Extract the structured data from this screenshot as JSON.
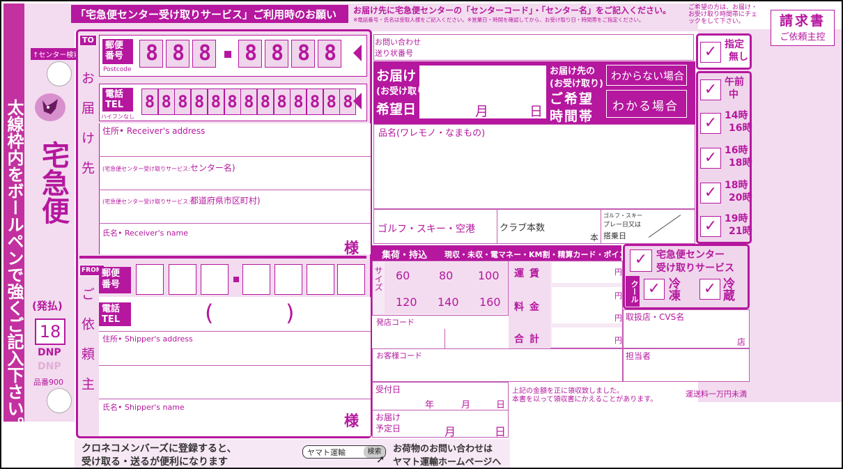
{
  "header": {
    "title": "「宅急便センター受け取りサービス」ご利用時のお願い",
    "notice_1": "お届け先に宅急便センターの「センターコード」・「センター名」をご記入ください。",
    "notice_2": "※電話番号・氏名は受取人様をご記入ください。※営業日・時間を確認してから、お受け取り日・時間帯をご指定ください。",
    "notice_3": "ご希望の方は、お届け・お受け取り時間帯にチェックをして下さい。"
  },
  "left_strip": {
    "search_label": "↑センター検索",
    "instruction": "太線枠内をボールペンで強くご記入下さい。",
    "brand": "宅急便",
    "brand_sub": "(発払)",
    "number": "18",
    "maker": "DNP",
    "maker_ghost": "DNP",
    "product_no": "品番900"
  },
  "to": {
    "badge": "TO",
    "title": "お届け先",
    "postcode_label": "郵便番号",
    "postcode_en": "Postcode",
    "postcode_digits": [
      "8",
      "8",
      "8",
      "8",
      "8",
      "8",
      "8"
    ],
    "tel_label": "電話TEL",
    "tel_note": "ハイフンなし",
    "tel_digits": [
      "8",
      "8",
      "8",
      "8",
      "8",
      "8",
      "8",
      "8",
      "8",
      "8",
      "8",
      "8",
      "8"
    ],
    "address_label": "住所• Receiver's address",
    "center_name_note": "(宅急便センター受け取りサービス:",
    "center_name_label": "センター名)",
    "prefecture_note": "(宅急便センター受け取りサービス:",
    "prefecture_label": "都道府県市区町村)",
    "name_label": "氏名• Receiver's name",
    "sama": "様"
  },
  "from": {
    "badge": "FROM",
    "title": "ご依頼主",
    "postcode_label": "郵便番号",
    "tel_label": "電話TEL",
    "paren_open": "(",
    "paren_close": ")",
    "address_label": "住所• Shipper's address",
    "name_label": "氏名• Shipper's name",
    "sama": "様"
  },
  "inquiry": {
    "label_1": "お問い合わせ",
    "label_2": "送り状番号"
  },
  "delivery_date": {
    "label_1": "お届け",
    "label_2": "(お受け取り)",
    "label_3": "希望日",
    "month": "月",
    "day": "日"
  },
  "time_band": {
    "label_1": "お届け先の",
    "label_2": "(お受け取り)",
    "label_3": "ご希望",
    "label_4": "時間帯",
    "unknown": "わからない場合",
    "known": "わかる場合"
  },
  "item": {
    "label": "品名(ワレモノ・なまもの)"
  },
  "golf": {
    "label": "ゴルフ・スキー・空港",
    "clubs": "クラブ本数",
    "clubs_unit": "本",
    "play_1": "ゴルフ・スキー",
    "play_2": "プレー日又は",
    "play_3": "搭乗日"
  },
  "time_options": [
    {
      "line1": "指定",
      "line2": "無し"
    },
    {
      "line1": "午前",
      "line2": "中"
    },
    {
      "line1": "14時",
      "line2": "16時"
    },
    {
      "line1": "16時",
      "line2": "18時"
    },
    {
      "line1": "18時",
      "line2": "20時"
    },
    {
      "line1": "19時",
      "line2": "21時"
    }
  ],
  "invoice": {
    "title": "請求書",
    "subtitle": "ご依頼主控"
  },
  "pickup": {
    "label": "集荷・持込",
    "payments": "現収・未収・電マネー・KM割・精算カード・ポイント"
  },
  "size": {
    "label": "サイズ",
    "row1": [
      "60",
      "80",
      "100"
    ],
    "row2": [
      "120",
      "140",
      "160"
    ]
  },
  "fees": {
    "fare": "運賃",
    "charge": "料金",
    "total": "合計",
    "yen": "円"
  },
  "center_service": {
    "line1": "宅急便センター",
    "line2": "受け取りサービス"
  },
  "cool": {
    "label": "クール",
    "frozen": "冷凍",
    "chilled": "冷蔵"
  },
  "store": {
    "label": "取扱店・CVS名",
    "suffix": "店"
  },
  "origin_code": "発店コード",
  "customer_code": "お客様コード",
  "staff": "担当者",
  "received_date": {
    "label": "受付日",
    "year": "年",
    "month": "月",
    "day": "日"
  },
  "expected_date": {
    "label_1": "お届け",
    "label_2": "予定日",
    "month": "月",
    "day": "日"
  },
  "receipt_note": {
    "line1": "上記の金額を正に領収致しました。",
    "line2": "本書を以って領収書にかえることがあります。"
  },
  "shipping_note": "運送料一万円未満",
  "footer": {
    "left_1": "クロネコメンバーズに登録すると、",
    "left_2": "受け取る・送るが便利になります",
    "search_box": "ヤマト運輸",
    "search_button": "検索",
    "right_1": "お荷物のお問い合わせは",
    "right_2": "ヤマト運輸ホームページへ"
  }
}
